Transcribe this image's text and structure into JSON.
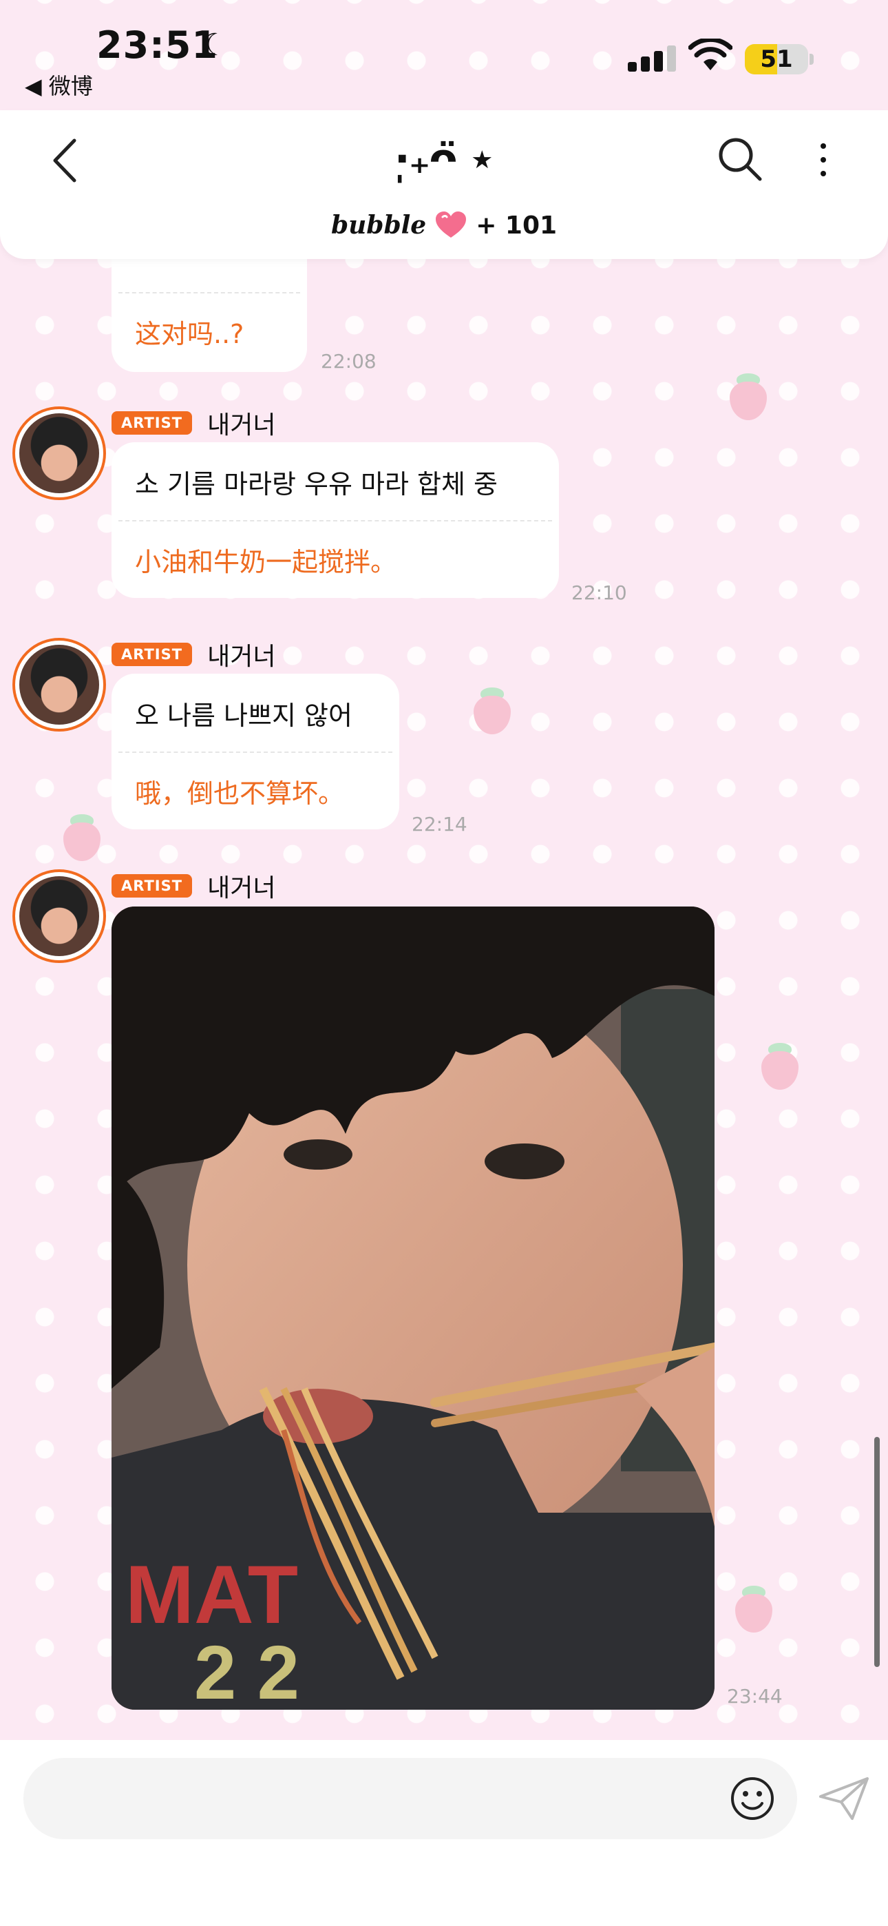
{
  "status_bar": {
    "time": "23:51",
    "back_app": "◀ 微博",
    "battery": "51"
  },
  "header": {
    "title": "·̩₊ᴖ̈ ⋆",
    "brand": "bubble",
    "count": "+ 101"
  },
  "messages": [
    {
      "translation": "这对吗..?",
      "time": "22:08",
      "partial": true
    },
    {
      "badge": "ARTIST",
      "sender": "내거너",
      "korean": "소 기름 마라랑 우유 마라 합체 중",
      "translation": "小油和牛奶一起搅拌。",
      "time": "22:10"
    },
    {
      "badge": "ARTIST",
      "sender": "내거너",
      "korean": "오 나름 나쁘지 않어",
      "translation": "哦，倒也不算坏。",
      "time": "22:14"
    },
    {
      "badge": "ARTIST",
      "sender": "내거너",
      "type": "photo",
      "time": "23:44"
    }
  ],
  "input": {
    "placeholder": ""
  },
  "colors": {
    "accent": "#f26b1f",
    "translation_text": "#ee6b20",
    "background": "#fce9f3"
  }
}
